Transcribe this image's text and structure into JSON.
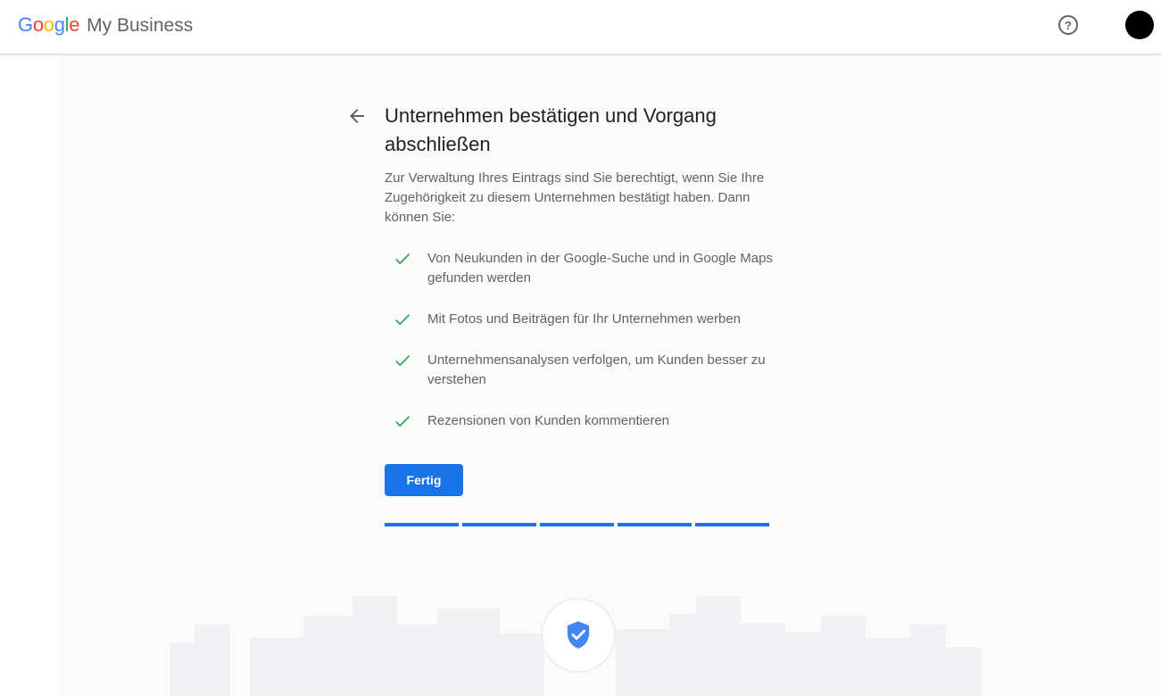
{
  "header": {
    "logo_google": "Google",
    "logo_product": "My Business",
    "help_icon": "help-circle-icon",
    "help_glyph": "?"
  },
  "page": {
    "title": "Unternehmen bestätigen und Vorgang abschließen",
    "description": "Zur Verwaltung Ihres Eintrags sind Sie berechtigt, wenn Sie Ihre Zugehörigkeit zu diesem Unternehmen bestätigt haben. Dann können Sie:",
    "benefits": [
      "Von Neukunden in der Google-Suche und in Google Maps gefunden werden",
      "Mit Fotos und Beiträgen für Ihr Unternehmen werben",
      "Unternehmensanalysen verfolgen, um Kunden besser zu verstehen",
      "Rezensionen von Kunden kommentieren"
    ],
    "done_label": "Fertig",
    "progress": {
      "completed_steps": 5,
      "total_steps": 5
    }
  },
  "colors": {
    "accent": "#1a73e8",
    "check": "#34a853",
    "google_blue": "#4285f4",
    "google_red": "#ea4335",
    "google_yellow": "#fbbc05",
    "google_green": "#34a853"
  }
}
